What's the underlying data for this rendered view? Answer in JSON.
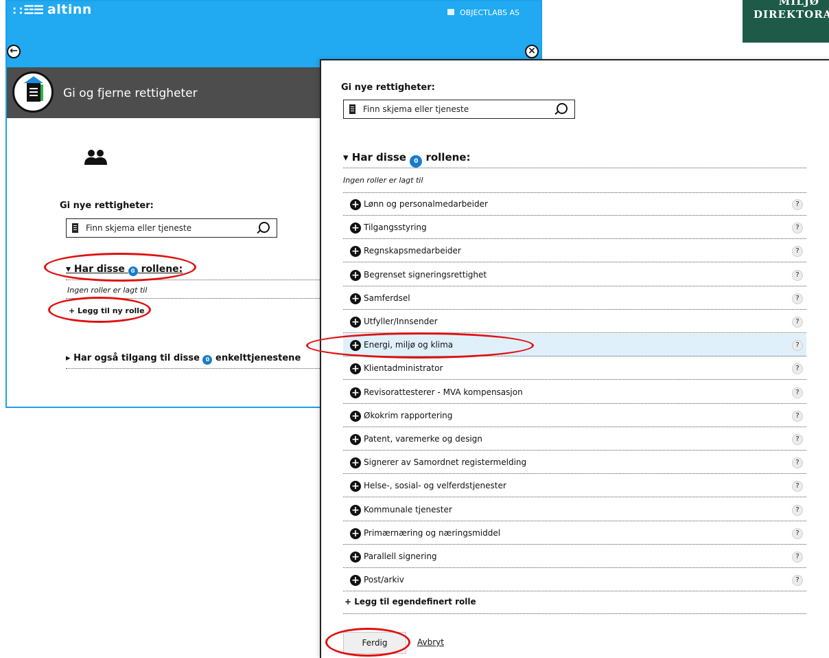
{
  "logo": {
    "line1": "MILJØ",
    "line2": "DIREKTORATET"
  },
  "header": {
    "brand_glyph": "::☲☰",
    "brand_name": "altinn",
    "organization": "OBJECTLABS AS"
  },
  "page": {
    "title": "Gi og fjerne rettigheter"
  },
  "left_panel": {
    "give_title": "Gi nye rettigheter:",
    "search_placeholder": "Finn skjema eller tjeneste",
    "roles_heading_pre": "Har disse",
    "roles_count": "0",
    "roles_heading_post": "rollene:",
    "no_roles": "Ingen roller er lagt til",
    "add_role": "+ Legg til ny rolle",
    "services_heading_pre": "Har også tilgang til disse",
    "services_count": "0",
    "services_heading_post": "enkelttjenestene"
  },
  "dialog": {
    "give_title": "Gi nye rettigheter:",
    "search_placeholder": "Finn skjema eller tjeneste",
    "roles_heading_pre": "Har disse",
    "roles_count": "0",
    "roles_heading_post": "rollene:",
    "no_roles": "Ingen roller er lagt til",
    "roles": [
      "Lønn og personalmedarbeider",
      "Tilgangsstyring",
      "Regnskapsmedarbeider",
      "Begrenset signeringsrettighet",
      "Samferdsel",
      "Utfyller/Innsender",
      "Energi, miljø og klima",
      "Klientadministrator",
      "Revisorattesterer - MVA kompensasjon",
      "Økokrim rapportering",
      "Patent, varemerke og design",
      "Signerer av Samordnet registermelding",
      "Helse-, sosial- og velferdstjenester",
      "Kommunale tjenester",
      "Primærnæring og næringsmiddel",
      "Parallell signering",
      "Post/arkiv"
    ],
    "highlighted_role_index": 6,
    "help_glyph": "?",
    "add_custom_role": "+ Legg til egendefinert rolle",
    "done_button": "Ferdig",
    "cancel_link": "Avbryt"
  },
  "icons": {
    "back": "arrow-left-icon",
    "close": "close-icon",
    "search": "magnifier-icon",
    "users": "users-icon",
    "add": "plus-circle-icon",
    "help": "question-icon"
  },
  "colors": {
    "header_blue": "#21a9f2",
    "title_bar": "#4d4d4d",
    "badge_blue": "#1a7cc8",
    "highlight_row": "#dff0fb",
    "annotation_red": "#e01010",
    "logo_green": "#1d5a48"
  }
}
